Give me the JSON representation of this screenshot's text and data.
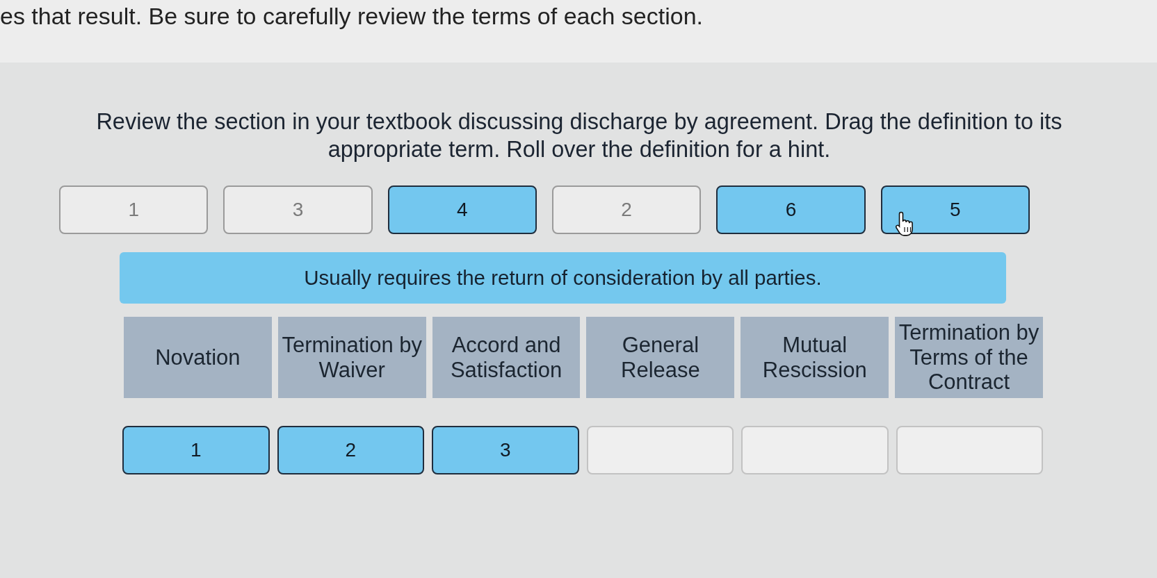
{
  "page": {
    "intro_text": "es that result. Be sure to carefully review the terms of each section."
  },
  "activity": {
    "instructions": "Review the section in your textbook discussing discharge by agreement. Drag the definition to its appropriate term. Roll over the definition for a hint.",
    "definition_tiles": [
      {
        "label": "1",
        "used": true
      },
      {
        "label": "3",
        "used": true
      },
      {
        "label": "4",
        "used": false
      },
      {
        "label": "2",
        "used": true
      },
      {
        "label": "6",
        "used": false
      },
      {
        "label": "5",
        "used": false
      }
    ],
    "hint": "Usually requires the return of consideration by all parties.",
    "terms": [
      "Novation",
      "Termination by Waiver",
      "Accord and Satisfaction",
      "General Release",
      "Mutual Rescission",
      "Termination by Terms of the Contract"
    ],
    "drop_slots": [
      {
        "filled": true,
        "label": "1"
      },
      {
        "filled": true,
        "label": "2"
      },
      {
        "filled": true,
        "label": "3"
      },
      {
        "filled": false
      },
      {
        "filled": false
      },
      {
        "filled": false
      }
    ]
  }
}
